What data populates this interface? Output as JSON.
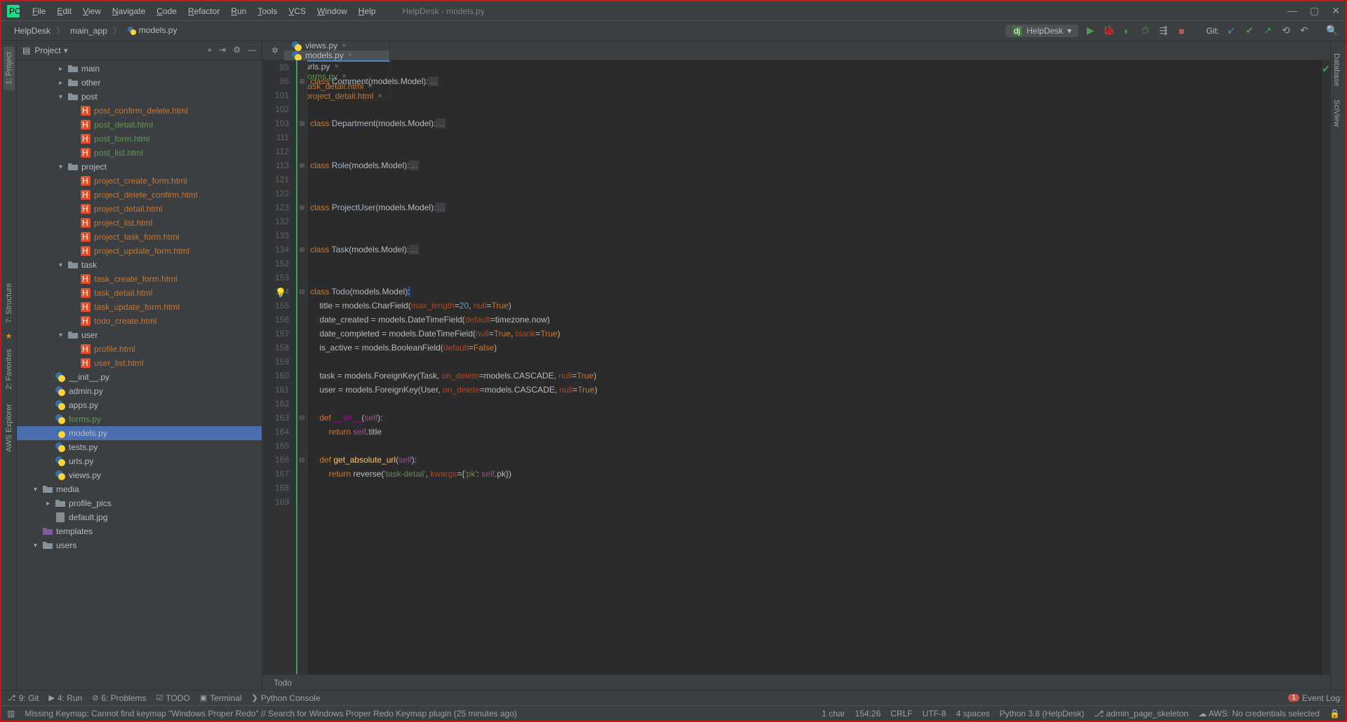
{
  "window": {
    "title": "HelpDesk - models.py"
  },
  "menu": [
    "File",
    "Edit",
    "View",
    "Navigate",
    "Code",
    "Refactor",
    "Run",
    "Tools",
    "VCS",
    "Window",
    "Help"
  ],
  "breadcrumbs": [
    "HelpDesk",
    "main_app",
    "models.py"
  ],
  "runConfig": "HelpDesk",
  "gitLabel": "Git:",
  "projectPanel": {
    "label": "Project"
  },
  "sideTabs": {
    "left": [
      "1: Project",
      "7: Structure",
      "2: Favorites",
      "AWS Explorer"
    ],
    "right": [
      "Database",
      "SciView"
    ]
  },
  "tree": [
    {
      "depth": 3,
      "chev": ">",
      "icon": "dir",
      "label": "main"
    },
    {
      "depth": 3,
      "chev": ">",
      "icon": "dir",
      "label": "other"
    },
    {
      "depth": 3,
      "chev": "v",
      "icon": "dir",
      "label": "post"
    },
    {
      "depth": 4,
      "chev": "",
      "icon": "html",
      "label": "post_confirm_delete.html",
      "cls": "html"
    },
    {
      "depth": 4,
      "chev": "",
      "icon": "html",
      "label": "post_detail.html",
      "cls": "green"
    },
    {
      "depth": 4,
      "chev": "",
      "icon": "html",
      "label": "post_form.html",
      "cls": "green"
    },
    {
      "depth": 4,
      "chev": "",
      "icon": "html",
      "label": "post_list.html",
      "cls": "green"
    },
    {
      "depth": 3,
      "chev": "v",
      "icon": "dir",
      "label": "project"
    },
    {
      "depth": 4,
      "chev": "",
      "icon": "html",
      "label": "project_create_form.html",
      "cls": "html"
    },
    {
      "depth": 4,
      "chev": "",
      "icon": "html",
      "label": "project_delete_confirm.html",
      "cls": "html"
    },
    {
      "depth": 4,
      "chev": "",
      "icon": "html",
      "label": "project_detail.html",
      "cls": "html"
    },
    {
      "depth": 4,
      "chev": "",
      "icon": "html",
      "label": "project_list.html",
      "cls": "html"
    },
    {
      "depth": 4,
      "chev": "",
      "icon": "html",
      "label": "project_task_form.html",
      "cls": "html"
    },
    {
      "depth": 4,
      "chev": "",
      "icon": "html",
      "label": "project_update_form.html",
      "cls": "html"
    },
    {
      "depth": 3,
      "chev": "v",
      "icon": "dir",
      "label": "task"
    },
    {
      "depth": 4,
      "chev": "",
      "icon": "html",
      "label": "task_create_form.html",
      "cls": "html"
    },
    {
      "depth": 4,
      "chev": "",
      "icon": "html",
      "label": "task_detail.html",
      "cls": "html"
    },
    {
      "depth": 4,
      "chev": "",
      "icon": "html",
      "label": "task_update_form.html",
      "cls": "html"
    },
    {
      "depth": 4,
      "chev": "",
      "icon": "html",
      "label": "todo_create.html",
      "cls": "html"
    },
    {
      "depth": 3,
      "chev": "v",
      "icon": "dir",
      "label": "user"
    },
    {
      "depth": 4,
      "chev": "",
      "icon": "html",
      "label": "profile.html",
      "cls": "html"
    },
    {
      "depth": 4,
      "chev": "",
      "icon": "html",
      "label": "user_list.html",
      "cls": "html"
    },
    {
      "depth": 2,
      "chev": "",
      "icon": "py",
      "label": "__init__.py"
    },
    {
      "depth": 2,
      "chev": "",
      "icon": "py",
      "label": "admin.py"
    },
    {
      "depth": 2,
      "chev": "",
      "icon": "py",
      "label": "apps.py"
    },
    {
      "depth": 2,
      "chev": "",
      "icon": "py",
      "label": "forms.py",
      "cls": "green"
    },
    {
      "depth": 2,
      "chev": "",
      "icon": "py",
      "label": "models.py",
      "selected": true
    },
    {
      "depth": 2,
      "chev": "",
      "icon": "py",
      "label": "tests.py"
    },
    {
      "depth": 2,
      "chev": "",
      "icon": "py",
      "label": "urls.py"
    },
    {
      "depth": 2,
      "chev": "",
      "icon": "py",
      "label": "views.py"
    },
    {
      "depth": 1,
      "chev": "v",
      "icon": "dir",
      "label": "media"
    },
    {
      "depth": 2,
      "chev": ">",
      "icon": "dir",
      "label": "profile_pics"
    },
    {
      "depth": 2,
      "chev": "",
      "icon": "file",
      "label": "default.jpg"
    },
    {
      "depth": 1,
      "chev": "",
      "icon": "dir-p",
      "label": "templates"
    },
    {
      "depth": 1,
      "chev": "v",
      "icon": "dir",
      "label": "users"
    }
  ],
  "tabs": [
    {
      "label": "views.py",
      "type": "py"
    },
    {
      "label": "models.py",
      "type": "py",
      "active": true
    },
    {
      "label": "urls.py",
      "type": "py"
    },
    {
      "label": "forms.py",
      "type": "py",
      "green": true
    },
    {
      "label": "task_detail.html",
      "type": "html"
    },
    {
      "label": "project_detail.html",
      "type": "html"
    }
  ],
  "code": {
    "lines": [
      85,
      86,
      101,
      102,
      103,
      111,
      112,
      113,
      121,
      122,
      123,
      132,
      133,
      134,
      152,
      153,
      154,
      155,
      156,
      157,
      158,
      159,
      160,
      161,
      162,
      163,
      164,
      165,
      166,
      167,
      168,
      169
    ],
    "rows": [
      "",
      "<span class='kw'>class </span><span class='cls'>Comment</span>(models.Model):<span class='fold'>...</span>",
      "",
      "",
      "<span class='kw'>class </span><span class='cls'>Department</span>(models.Model):<span class='fold'>...</span>",
      "",
      "",
      "<span class='kw'>class </span><span class='cls'>Role</span>(models.Model):<span class='fold'>...</span>",
      "",
      "",
      "<span class='kw'>class </span><span class='cls'>ProjectUser</span>(models.Model):<span class='fold'>...</span>",
      "",
      "",
      "<span class='kw'>class </span><span class='cls'>Task</span>(models.Model):<span class='fold'>...</span>",
      "",
      "",
      "<span class='kw'>class </span><span class='cls'>Todo</span>(models.Model)<span style='background:#214283'>:</span>",
      "    title = models.CharField(<span class='param'>max_length</span>=<span class='num'>20</span>, <span class='param'>null</span>=<span class='bool'>True</span>)",
      "    date_created = models.DateTimeField(<span class='param'>default</span>=timezone.now)",
      "    date_completed = models.DateTimeField(<span class='param'>null</span>=<span class='bool'>True</span>, <span class='param'>blank</span>=<span class='bool'>True</span>)",
      "    is_active = models.BooleanField(<span class='param'>default</span>=<span class='bool'>False</span>)",
      "",
      "    task = models.ForeignKey(Task, <span class='param'>on_delete</span>=models.CASCADE, <span class='param'>null</span>=<span class='bool'>True</span>)",
      "    user = models.ForeignKey(User, <span class='param'>on_delete</span>=models.CASCADE, <span class='param'>null</span>=<span class='bool'>True</span>)",
      "",
      "    <span class='kw'>def </span><span class='magic'>__str__</span>(<span class='self'>self</span>):",
      "        <span class='kw'>return </span><span class='self'>self</span>.title",
      "",
      "    <span class='kw'>def </span><span class='fn'>get_absolute_url</span>(<span class='self'>self</span>):",
      "        <span class='kw'>return </span>reverse(<span class='str'>'task-detail'</span>, <span class='param'>kwargs</span>={<span class='str'>'pk'</span>: <span class='self'>self</span>.pk})",
      "",
      ""
    ]
  },
  "editorBreadcrumb": "Todo",
  "bottomTools": [
    "9: Git",
    "4: Run",
    "6: Problems",
    "TODO",
    "Terminal",
    "Python Console"
  ],
  "eventLog": "Event Log",
  "status": {
    "msg": "Missing Keymap: Cannot find keymap \"Windows Proper Redo\" // Search for Windows Proper Redo Keymap plugin (25 minutes ago)",
    "chars": "1 char",
    "pos": "154:26",
    "lineend": "CRLF",
    "enc": "UTF-8",
    "indent": "4 spaces",
    "interp": "Python 3.8 (HelpDesk)",
    "branch": "admin_page_skeleton",
    "aws": "AWS: No credentials selected"
  }
}
